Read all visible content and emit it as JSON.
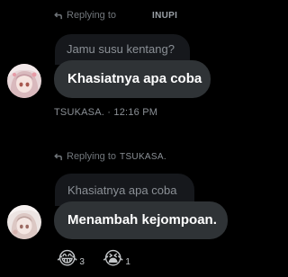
{
  "thread": [
    {
      "replying_label": "Replying to",
      "replying_to": "INUPI",
      "quoted_text": "Jamu susu kentang?",
      "message_text": "Khasiatnya apa coba",
      "sender": "TSUKASA.",
      "separator": "·",
      "timestamp": "12:16 PM"
    },
    {
      "replying_label": "Replying to",
      "replying_to": "TSUKASA.",
      "quoted_text": "Khasiatnya apa coba",
      "message_text": "Menambah kejompoan.",
      "reactions": [
        {
          "emoji": "😂",
          "count": "3"
        },
        {
          "emoji": "😭",
          "count": "1"
        }
      ]
    }
  ],
  "colors": {
    "background": "#000000",
    "bubble": "#2f3336",
    "quote_bubble": "#16181c",
    "muted_text": "#71767b"
  },
  "icons": [
    "reply-arrow-icon",
    "avatar-anime-icon"
  ]
}
